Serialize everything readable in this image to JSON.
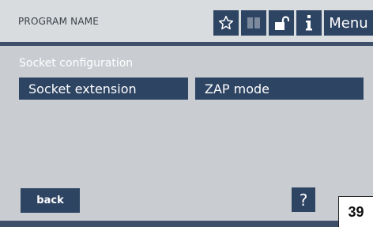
{
  "header": {
    "program_name": "PROGRAM NAME",
    "icons": [
      "star-icon",
      "book-icon",
      "unlock-icon",
      "info-icon"
    ],
    "menu_label": "Menu"
  },
  "main": {
    "section_title": "Socket configuration",
    "buttons": [
      {
        "label": "Socket extension"
      },
      {
        "label": "ZAP mode"
      }
    ]
  },
  "footer": {
    "back_label": "back",
    "help_label": "?",
    "page_number": "39"
  },
  "colors": {
    "screen_bg": "#c9cdd2",
    "header_bg": "#d9dcdf",
    "button_bg": "#2e4463",
    "accent_line": "#3e4f6a"
  }
}
